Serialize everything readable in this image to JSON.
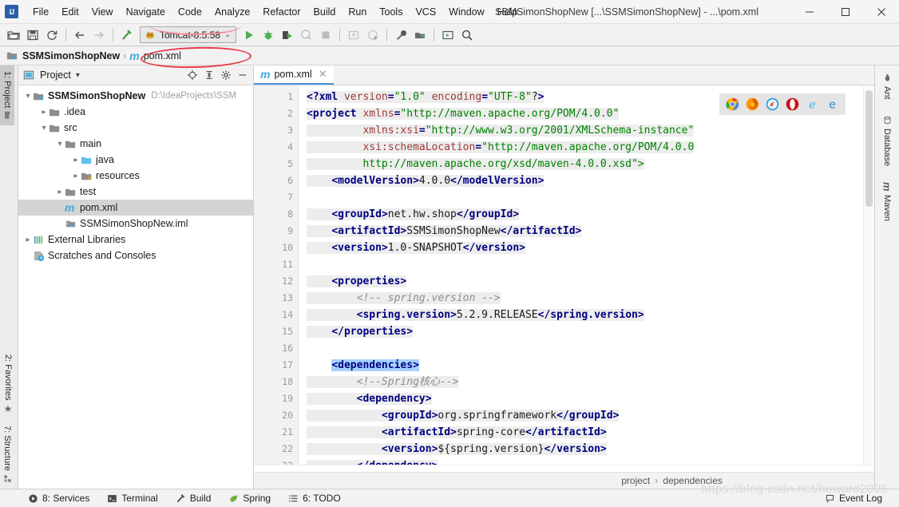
{
  "window": {
    "title": "SSMSimonShopNew [...\\SSMSimonShopNew] - ...\\pom.xml",
    "minimize": "—",
    "maximize": "☐",
    "close": "✕",
    "logo": "IJ"
  },
  "menubar": {
    "items": [
      {
        "label": "File"
      },
      {
        "label": "Edit"
      },
      {
        "label": "View"
      },
      {
        "label": "Navigate"
      },
      {
        "label": "Code"
      },
      {
        "label": "Analyze"
      },
      {
        "label": "Refactor"
      },
      {
        "label": "Build"
      },
      {
        "label": "Run"
      },
      {
        "label": "Tools"
      },
      {
        "label": "VCS"
      },
      {
        "label": "Window"
      },
      {
        "label": "Help"
      }
    ]
  },
  "toolbar": {
    "open_label": "open-folder-icon",
    "save_label": "save-icon",
    "sync_label": "sync-icon",
    "back_label": "back-arrow-icon",
    "forward_label": "forward-arrow-icon",
    "build_label": "hammer-icon",
    "run_config": {
      "name": "Tomcat-8.5.58",
      "chevron": "⌄"
    },
    "run": "run-icon",
    "debug": "debug-icon",
    "run_coverage": "run-with-coverage-icon",
    "profile": "profile-icon",
    "stop": "stop-icon",
    "update": "update-app-icon",
    "redeploy": "redeploy-icon",
    "settings": "wrench-icon",
    "project_structure": "project-structure-icon",
    "select_in": "select-in-icon",
    "search": "search-everywhere-icon"
  },
  "navbar": {
    "project": "SSMSimonShopNew",
    "separator": "›",
    "file": "pom.xml",
    "file_badge": "m"
  },
  "left_tool_strip": {
    "tabs": [
      {
        "label": "1: Project",
        "active": true
      },
      {
        "label": "2: Favorites",
        "active": false
      },
      {
        "label": "7: Structure",
        "active": false
      }
    ]
  },
  "right_tool_strip": {
    "tabs": [
      {
        "label": "Ant"
      },
      {
        "label": "Database"
      },
      {
        "label": "Maven"
      }
    ]
  },
  "project_panel": {
    "title": "Project",
    "dropdown": "▾",
    "actions": [
      {
        "name": "locate-icon",
        "glyph": "⊕"
      },
      {
        "name": "collapse-all-icon",
        "glyph": "⇥"
      },
      {
        "name": "settings-gear-icon",
        "glyph": "✿"
      },
      {
        "name": "hide-icon",
        "glyph": "—"
      }
    ],
    "tree": [
      {
        "label": "SSMSimonShopNew",
        "sub": "D:\\IdeaProjects\\SSM",
        "indent": 0,
        "twisty": "⌄",
        "icon": "project-folder",
        "bold": true,
        "selected": false
      },
      {
        "label": ".idea",
        "sub": "",
        "indent": 1,
        "twisty": "›",
        "icon": "folder",
        "bold": false,
        "selected": false
      },
      {
        "label": "src",
        "sub": "",
        "indent": 1,
        "twisty": "⌄",
        "icon": "folder",
        "bold": false,
        "selected": false
      },
      {
        "label": "main",
        "sub": "",
        "indent": 2,
        "twisty": "⌄",
        "icon": "folder",
        "bold": false,
        "selected": false
      },
      {
        "label": "java",
        "sub": "",
        "indent": 3,
        "twisty": "›",
        "icon": "folder-source",
        "bold": false,
        "selected": false
      },
      {
        "label": "resources",
        "sub": "",
        "indent": 3,
        "twisty": "›",
        "icon": "folder-resources",
        "bold": false,
        "selected": false
      },
      {
        "label": "test",
        "sub": "",
        "indent": 2,
        "twisty": "›",
        "icon": "folder",
        "bold": false,
        "selected": false
      },
      {
        "label": "pom.xml",
        "sub": "",
        "indent": 2,
        "twisty": "",
        "icon": "maven-m",
        "bold": false,
        "selected": true
      },
      {
        "label": "SSMSimonShopNew.iml",
        "sub": "",
        "indent": 2,
        "twisty": "",
        "icon": "iml",
        "bold": false,
        "selected": false
      },
      {
        "label": "External Libraries",
        "sub": "",
        "indent": 0,
        "twisty": "›",
        "icon": "libraries",
        "bold": false,
        "selected": false
      },
      {
        "label": "Scratches and Consoles",
        "sub": "",
        "indent": 0,
        "twisty": "",
        "icon": "scratches",
        "bold": false,
        "selected": false
      }
    ]
  },
  "editor": {
    "tab": {
      "label": "pom.xml",
      "badge": "m",
      "close": "✕"
    },
    "inspection_status": "✔",
    "browsers": [
      {
        "name": "chrome-icon",
        "color": "#4285f4"
      },
      {
        "name": "firefox-icon",
        "color": "#e66000"
      },
      {
        "name": "safari-icon",
        "color": "#3b9de0"
      },
      {
        "name": "opera-icon",
        "color": "#cc0f16"
      },
      {
        "name": "internet-explorer-icon",
        "color": "#3bb0e8"
      },
      {
        "name": "edge-icon",
        "color": "#2e8ed6"
      }
    ],
    "breadcrumb": [
      {
        "label": "project"
      },
      {
        "label": "›"
      },
      {
        "label": "dependencies"
      }
    ],
    "lines": [
      {
        "n": 1,
        "fold": "",
        "text": "<?xml version=\"1.0\" encoding=\"UTF-8\"?>"
      },
      {
        "n": 2,
        "fold": "−",
        "text": "<project xmlns=\"http://maven.apache.org/POM/4.0.0\""
      },
      {
        "n": 3,
        "fold": "",
        "text": "         xmlns:xsi=\"http://www.w3.org/2001/XMLSchema-instance\""
      },
      {
        "n": 4,
        "fold": "",
        "text": "         xsi:schemaLocation=\"http://maven.apache.org/POM/4.0.0"
      },
      {
        "n": 5,
        "fold": "",
        "text": "         http://maven.apache.org/xsd/maven-4.0.0.xsd\">"
      },
      {
        "n": 6,
        "fold": "",
        "text": "    <modelVersion>4.0.0</modelVersion>"
      },
      {
        "n": 7,
        "fold": "",
        "text": ""
      },
      {
        "n": 8,
        "fold": "",
        "text": "    <groupId>net.hw.shop</groupId>"
      },
      {
        "n": 9,
        "fold": "",
        "text": "    <artifactId>SSMSimonShopNew</artifactId>"
      },
      {
        "n": 10,
        "fold": "",
        "text": "    <version>1.0-SNAPSHOT</version>"
      },
      {
        "n": 11,
        "fold": "",
        "text": ""
      },
      {
        "n": 12,
        "fold": "−",
        "text": "    <properties>"
      },
      {
        "n": 13,
        "fold": "",
        "text": "        <!-- spring.version -->"
      },
      {
        "n": 14,
        "fold": "",
        "text": "        <spring.version>5.2.9.RELEASE</spring.version>"
      },
      {
        "n": 15,
        "fold": "−",
        "text": "    </properties>"
      },
      {
        "n": 16,
        "fold": "",
        "text": ""
      },
      {
        "n": 17,
        "fold": "−",
        "text": "    <dependencies>"
      },
      {
        "n": 18,
        "fold": "",
        "text": "        <!--Spring核心-->"
      },
      {
        "n": 19,
        "fold": "−",
        "text": "        <dependency>"
      },
      {
        "n": 20,
        "fold": "",
        "text": "            <groupId>org.springframework</groupId>"
      },
      {
        "n": 21,
        "fold": "",
        "text": "            <artifactId>spring-core</artifactId>"
      },
      {
        "n": 22,
        "fold": "",
        "text": "            <version>${spring.version}</version>"
      },
      {
        "n": 23,
        "fold": "−",
        "text": "        </dependency>"
      }
    ]
  },
  "statusbar": {
    "items": [
      {
        "label": "8: Services",
        "icon": "services-icon"
      },
      {
        "label": "Terminal",
        "icon": "terminal-icon"
      },
      {
        "label": "Build",
        "icon": "build-hammer-icon"
      },
      {
        "label": "Spring",
        "icon": "spring-leaf-icon"
      },
      {
        "label": "6: TODO",
        "icon": "todo-list-icon"
      }
    ],
    "event_log": "Event Log"
  },
  "watermark": "https://blog.csdn.net/howard2005",
  "colors": {
    "accent": "#4a90d9",
    "tag": "#000080",
    "attr": "#9e3a3a",
    "value": "#008000",
    "comment": "#8c8c8c",
    "selection": "#a6d2ff",
    "highlight": "#ededed",
    "annotation_red": "#e8394a"
  }
}
